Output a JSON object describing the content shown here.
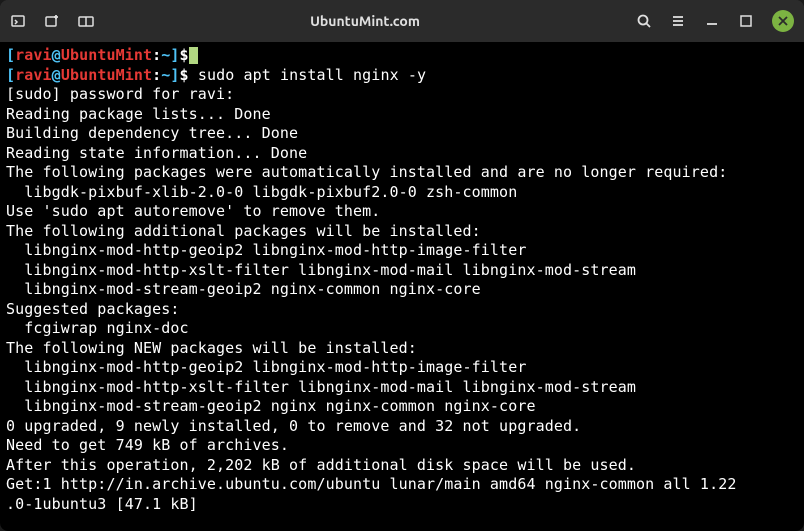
{
  "titlebar": {
    "title": "UbuntuMint.com"
  },
  "prompt": {
    "user": "ravi",
    "host": "UbuntuMint",
    "path": "~",
    "dollar": "$"
  },
  "command": "sudo apt install nginx -y",
  "output": {
    "l1": "[sudo] password for ravi:",
    "l2": "Reading package lists... Done",
    "l3": "Building dependency tree... Done",
    "l4": "Reading state information... Done",
    "l5": "The following packages were automatically installed and are no longer required:",
    "l6": "  libgdk-pixbuf-xlib-2.0-0 libgdk-pixbuf2.0-0 zsh-common",
    "l7": "Use 'sudo apt autoremove' to remove them.",
    "l8": "The following additional packages will be installed:",
    "l9": "  libnginx-mod-http-geoip2 libnginx-mod-http-image-filter",
    "l10": "  libnginx-mod-http-xslt-filter libnginx-mod-mail libnginx-mod-stream",
    "l11": "  libnginx-mod-stream-geoip2 nginx-common nginx-core",
    "l12": "Suggested packages:",
    "l13": "  fcgiwrap nginx-doc",
    "l14": "The following NEW packages will be installed:",
    "l15": "  libnginx-mod-http-geoip2 libnginx-mod-http-image-filter",
    "l16": "  libnginx-mod-http-xslt-filter libnginx-mod-mail libnginx-mod-stream",
    "l17": "  libnginx-mod-stream-geoip2 nginx nginx-common nginx-core",
    "l18": "0 upgraded, 9 newly installed, 0 to remove and 32 not upgraded.",
    "l19": "Need to get 749 kB of archives.",
    "l20": "After this operation, 2,202 kB of additional disk space will be used.",
    "l21": "Get:1 http://in.archive.ubuntu.com/ubuntu lunar/main amd64 nginx-common all 1.22",
    "l22": ".0-1ubuntu3 [47.1 kB]"
  }
}
